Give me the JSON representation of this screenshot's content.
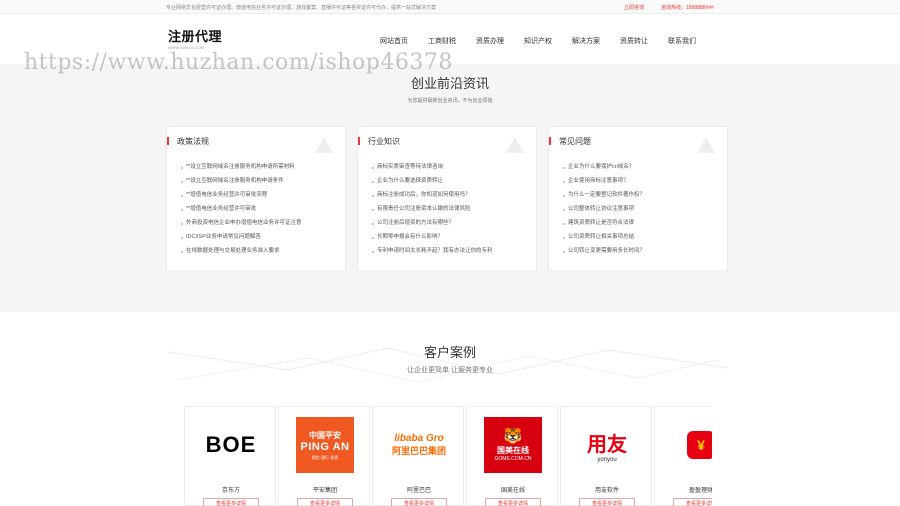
{
  "topbar": {
    "tagline": "专业网络文化经营许可证办理、增值电信业务许可证办理、游戏备案、直播许可证等各资证许可代办，提供一站式解决方案",
    "consult": "立即咨询",
    "hotline": "咨询热线：1998888###"
  },
  "header": {
    "logo_text": "注册代理",
    "logo_sub": "WWW.XXXXX.COM",
    "nav": [
      "网站首页",
      "工商财税",
      "资质办理",
      "知识产权",
      "解决方案",
      "资质转让",
      "联系我们"
    ]
  },
  "watermark": "https://www.huzhan.com/ishop46378",
  "news": {
    "title": "创业前沿资讯",
    "subtitle": "为您提供最新创业资讯，不为创业烦恼",
    "cards": [
      {
        "heading": "政策法规",
        "items": [
          "**设立互联网域名注册服务机构申请所需材料",
          "**设立互联网域名注册服务机构申请条件",
          "**增值电信业务经营许可审批流程",
          "**增值电信业务经营许可审批",
          "外商投资电信企业申办增值电信业务许可证注意",
          "IDC/ISP业务申请常见问题解答",
          "在线数据处理与交易处理业务准入要求"
        ]
      },
      {
        "heading": "行业知识",
        "items": [
          "商标实质审查等待法律咨询",
          "企业为什么要选择资质转让",
          "商标注册成功后，你知道如何使用吗？",
          "有限责任公司注册资本认缴的法律风险",
          "公司注册后增资的方法有哪些？",
          "长期零申报会有什么影响？",
          "专利申请时间太长耗不起？我有办法让你的专利"
        ]
      },
      {
        "heading": "常见问题",
        "items": [
          "企业为什么要保护cn域名？",
          "企业使用商标注意事项？",
          "为什么一定要登记软件著作权？",
          "公司整体转让协议注意事项",
          "建筑资质转让是否符合法律",
          "公司资质转让相关事项总结",
          "公司转让变更需要用多长时间？"
        ]
      }
    ]
  },
  "cases": {
    "title": "客户案例",
    "subtitle": "让企业更简单  让服务更专业",
    "button_label": "查看更多详情",
    "logos": [
      {
        "name": "京东方",
        "icon": "boe-logo",
        "text": "BOE"
      },
      {
        "name": "平安集团",
        "icon": "pingan-logo",
        "line1": "中国平安",
        "line2": "PING AN",
        "line3": "保险·银行·投资"
      },
      {
        "name": "阿里巴巴",
        "icon": "alibaba-logo",
        "line1": "libaba Gro",
        "line2": "阿里巴巴集团"
      },
      {
        "name": "国美在线",
        "icon": "gome-logo",
        "line1": "国美在线",
        "line2": "GOME.COM.CN"
      },
      {
        "name": "用友软件",
        "icon": "yonyou-logo",
        "line1": "用友",
        "line2": "yonyou"
      },
      {
        "name": "盈盈理财",
        "icon": "yingying-logo",
        "glyph": "¥"
      }
    ]
  },
  "colors": {
    "accent": "#e33333",
    "section_bg": "#f5f5f5",
    "pingan_orange": "#f05a22",
    "gome_red": "#d7000f"
  }
}
